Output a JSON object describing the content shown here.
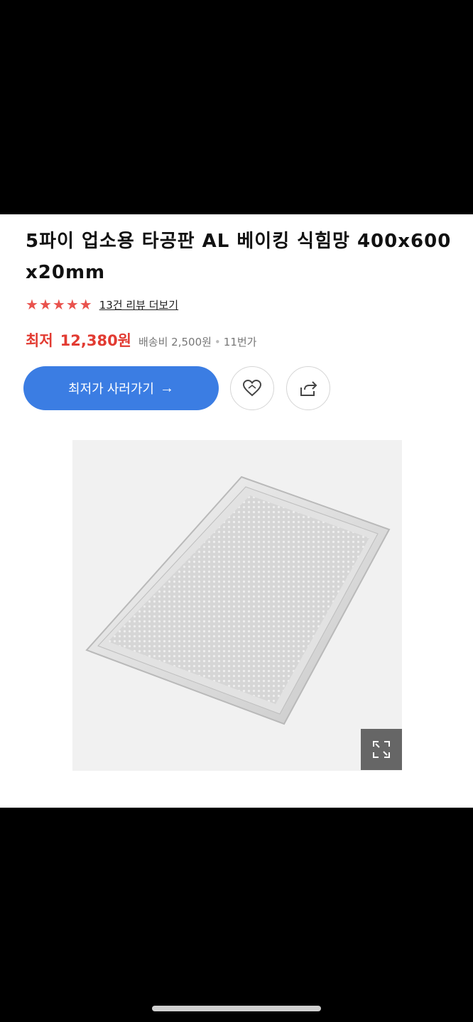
{
  "product": {
    "title": "5파이 업소용 타공판 AL 베이킹 식힘망 400x600x20mm",
    "rating": 4.5,
    "rating_max": 5,
    "review_link": "13건 리뷰 더보기"
  },
  "price": {
    "label": "최저",
    "value": "12,380원",
    "shipping": "배송비 2,500원",
    "separator": "•",
    "store": "11번가"
  },
  "actions": {
    "buy_label": "최저가 사러가기",
    "buy_arrow": "→",
    "wishlist_icon": "heart-icon",
    "share_icon": "share-icon",
    "expand_icon": "expand-icon"
  },
  "colors": {
    "accent": "#3b7de3",
    "price": "#e23b32",
    "star": "#e9524d"
  }
}
